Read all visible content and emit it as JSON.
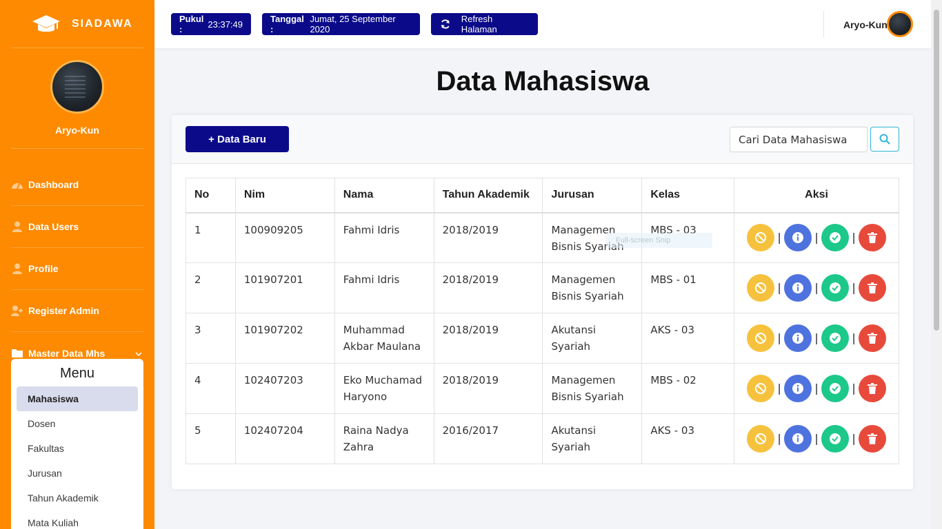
{
  "app": {
    "brand": "SIADAWA",
    "user_name": "Aryo-Kun"
  },
  "topbar": {
    "time_label": "Pukul :",
    "time_value": "23:37:49",
    "date_label": "Tanggal :",
    "date_value": "Jumat, 25 September 2020",
    "refresh_label": "Refresh Halaman",
    "user_name": "Aryo-Kun"
  },
  "sidebar": {
    "items": [
      {
        "label": "Dashboard",
        "icon": "dashboard-icon"
      },
      {
        "label": "Data Users",
        "icon": "user-icon"
      },
      {
        "label": "Profile",
        "icon": "user-icon"
      },
      {
        "label": "Register Admin",
        "icon": "user-plus-icon"
      }
    ],
    "master": {
      "label": "Master Data Mhs",
      "icon": "folder-icon"
    },
    "submenu": {
      "title": "Menu",
      "items": [
        "Mahasiswa",
        "Dosen",
        "Fakultas",
        "Jurusan",
        "Tahun Akademik",
        "Mata Kuliah"
      ],
      "active": "Mahasiswa"
    }
  },
  "main": {
    "title": "Data Mahasiswa",
    "new_button": "+ Data Baru",
    "search_placeholder": "Cari Data Mahasiswa",
    "tooltip": "Full-screen Snip",
    "table": {
      "headers": [
        "No",
        "Nim",
        "Nama",
        "Tahun Akademik",
        "Jurusan",
        "Kelas",
        "Aksi"
      ],
      "rows": [
        {
          "no": "1",
          "nim": "100909205",
          "nama": "Fahmi Idris",
          "tahun": "2018/2019",
          "jurusan": "Managemen Bisnis Syariah",
          "kelas": "MBS - 03"
        },
        {
          "no": "2",
          "nim": "101907201",
          "nama": "Fahmi Idris",
          "tahun": "2018/2019",
          "jurusan": "Managemen Bisnis Syariah",
          "kelas": "MBS - 01"
        },
        {
          "no": "3",
          "nim": "101907202",
          "nama": "Muhammad Akbar Maulana",
          "tahun": "2018/2019",
          "jurusan": "Akutansi Syariah",
          "kelas": "AKS - 03"
        },
        {
          "no": "4",
          "nim": "102407203",
          "nama": "Eko Muchamad Haryono",
          "tahun": "2018/2019",
          "jurusan": "Managemen Bisnis Syariah",
          "kelas": "MBS - 02"
        },
        {
          "no": "5",
          "nim": "102407204",
          "nama": "Raina Nadya Zahra",
          "tahun": "2016/2017",
          "jurusan": "Akutansi Syariah",
          "kelas": "AKS - 03"
        }
      ],
      "actions": [
        {
          "name": "deactivate",
          "icon": "ban-icon",
          "color": "#f6c23e"
        },
        {
          "name": "info",
          "icon": "info-icon",
          "color": "#4e73df"
        },
        {
          "name": "activate",
          "icon": "check-icon",
          "color": "#1cc88a"
        },
        {
          "name": "delete",
          "icon": "trash-icon",
          "color": "#e74a3b"
        }
      ]
    }
  },
  "colors": {
    "sidebar": "#fd8a00",
    "primary": "#0b0b8a",
    "page_bg": "#f3f4f8"
  }
}
